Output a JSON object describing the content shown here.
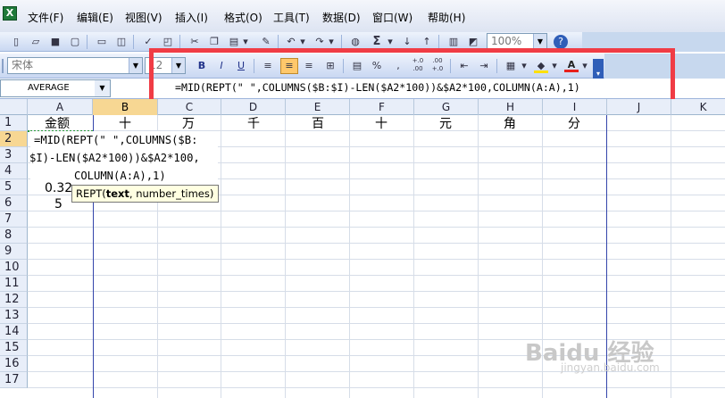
{
  "menubar": {
    "app_icon": "excel-icon",
    "items": [
      "文件(F)",
      "编辑(E)",
      "视图(V)",
      "插入(I)",
      "格式(O)",
      "工具(T)",
      "数据(D)",
      "窗口(W)",
      "帮助(H)"
    ]
  },
  "toolbar": {
    "zoom": "100%",
    "font_name": "宋体",
    "font_size": "12",
    "bold": "B",
    "italic": "I",
    "underline": "U",
    "percent": "%",
    "comma": ",",
    "inc_decimal": "+.0\n.00",
    "dec_decimal": ".00\n+.0",
    "font_color_label": "A",
    "sum": "Σ"
  },
  "formula_bar": {
    "name_box": "AVERAGE",
    "formula": "=MID(REPT(\" \",COLUMNS($B:$I)-LEN($A2*100))&$A2*100,COLUMN(A:A),1)"
  },
  "columns": [
    "A",
    "B",
    "C",
    "D",
    "E",
    "F",
    "G",
    "H",
    "I",
    "J",
    "K"
  ],
  "rows": [
    "1",
    "2",
    "3",
    "4",
    "5",
    "6",
    "7",
    "8",
    "9",
    "10",
    "11",
    "12",
    "13",
    "14",
    "15",
    "16",
    "17"
  ],
  "cells": {
    "A1": "金额",
    "B1": "十",
    "C1": "万",
    "D1": "千",
    "E1": "百",
    "F1": "十",
    "G1": "元",
    "H1": "角",
    "I1": "分",
    "A5": "0.32",
    "A6": "5"
  },
  "editing": {
    "line1": "=MID(REPT(\" \",COLUMNS($B:",
    "line2": "$I)-LEN($A2*100))&$A2*100,",
    "line3": "COLUMN(A:A),1)"
  },
  "tooltip": {
    "func": "REPT(",
    "arg1": "text",
    "rest": ", number_times)"
  },
  "watermark": {
    "main": "Baidu 经验",
    "sub": "jingyan.baidu.com"
  },
  "colors": {
    "highlight": "#f03c45",
    "selected_header": "#f7d793",
    "toolbar": "#c9d8f2"
  }
}
